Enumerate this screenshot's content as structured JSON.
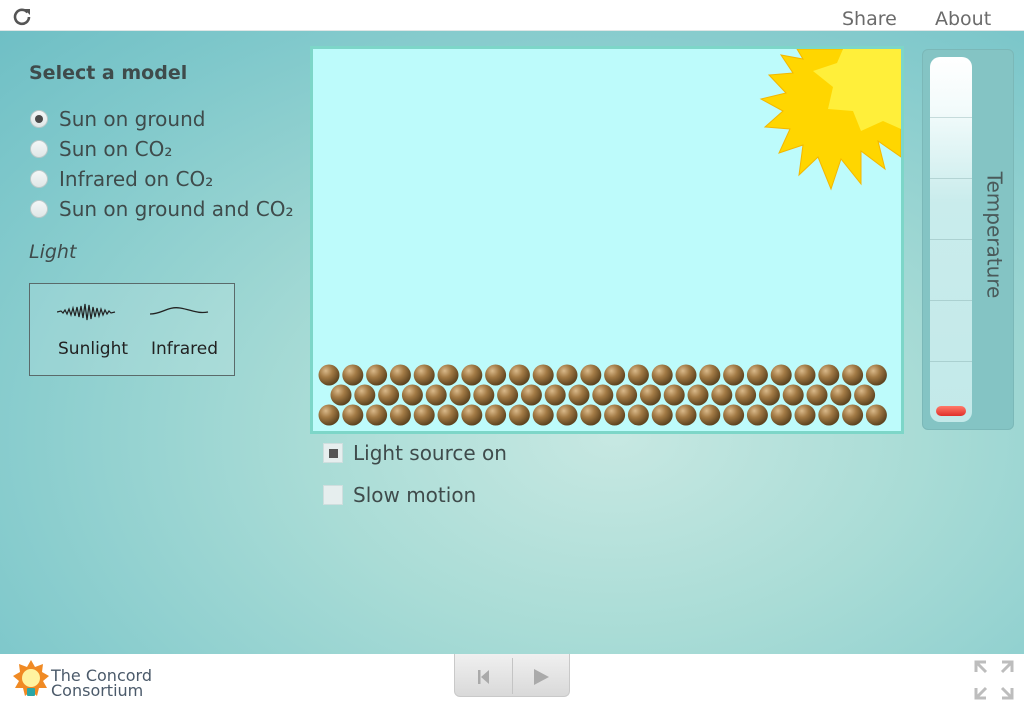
{
  "header": {
    "reload_icon": "reload-icon",
    "share_label": "Share",
    "about_label": "About"
  },
  "model_panel": {
    "title": "Select a model",
    "options": [
      {
        "label": "Sun on ground",
        "selected": true
      },
      {
        "label": "Sun on CO₂",
        "selected": false
      },
      {
        "label": "Infrared on CO₂",
        "selected": false
      },
      {
        "label": "Sun on ground and CO₂",
        "selected": false
      }
    ]
  },
  "light_legend": {
    "heading": "Light",
    "sunlight_label": "Sunlight",
    "infrared_label": "Infrared"
  },
  "thermometer": {
    "label": "Temperature",
    "level": 0.02,
    "fill_color": "#e8433a"
  },
  "controls": {
    "light_source_label": "Light source on",
    "light_source_checked": true,
    "slow_motion_label": "Slow motion",
    "slow_motion_checked": false
  },
  "footer": {
    "logo_line1": "The Concord",
    "logo_line2": "Consortium"
  },
  "colors": {
    "sim_background": "#bdfbfb",
    "sim_border": "#7dd6c8",
    "sun": "#ffd600",
    "ground_particle": "#8a6a3a"
  }
}
